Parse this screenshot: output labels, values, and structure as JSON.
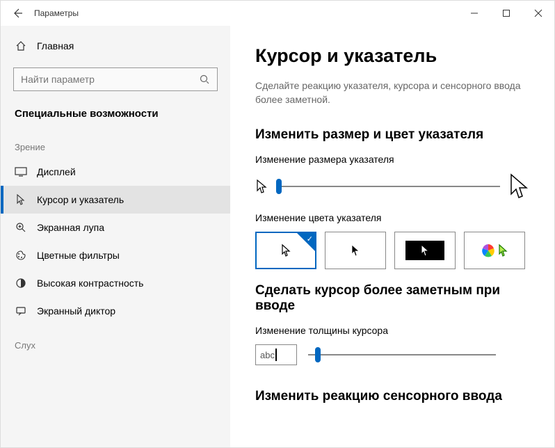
{
  "window": {
    "title": "Параметры"
  },
  "sidebar": {
    "home": "Главная",
    "search_placeholder": "Найти параметр",
    "section": "Специальные возможности",
    "groups": [
      {
        "label": "Зрение",
        "items": [
          {
            "label": "Дисплей",
            "icon": "display-icon"
          },
          {
            "label": "Курсор и указатель",
            "icon": "cursor-icon",
            "active": true
          },
          {
            "label": "Экранная лупа",
            "icon": "magnifier-icon"
          },
          {
            "label": "Цветные фильтры",
            "icon": "palette-icon"
          },
          {
            "label": "Высокая контрастность",
            "icon": "contrast-icon"
          },
          {
            "label": "Экранный диктор",
            "icon": "narrator-icon"
          }
        ]
      },
      {
        "label": "Слух",
        "items": []
      }
    ]
  },
  "content": {
    "title": "Курсор и указатель",
    "desc": "Сделайте реакцию указателя, курсора и сенсорного ввода более заметной.",
    "section1": "Изменить размер и цвет указателя",
    "size_label": "Изменение размера указателя",
    "color_label": "Изменение цвета указателя",
    "pointer_size": {
      "value": 1,
      "min": 1,
      "max": 15
    },
    "pointer_color_selected": 0,
    "section2": "Сделать курсор более заметным при вводе",
    "thickness_label": "Изменение толщины курсора",
    "thickness_preview": "abc",
    "thickness": {
      "value": 1,
      "min": 1,
      "max": 20
    },
    "section3": "Изменить реакцию сенсорного ввода"
  }
}
